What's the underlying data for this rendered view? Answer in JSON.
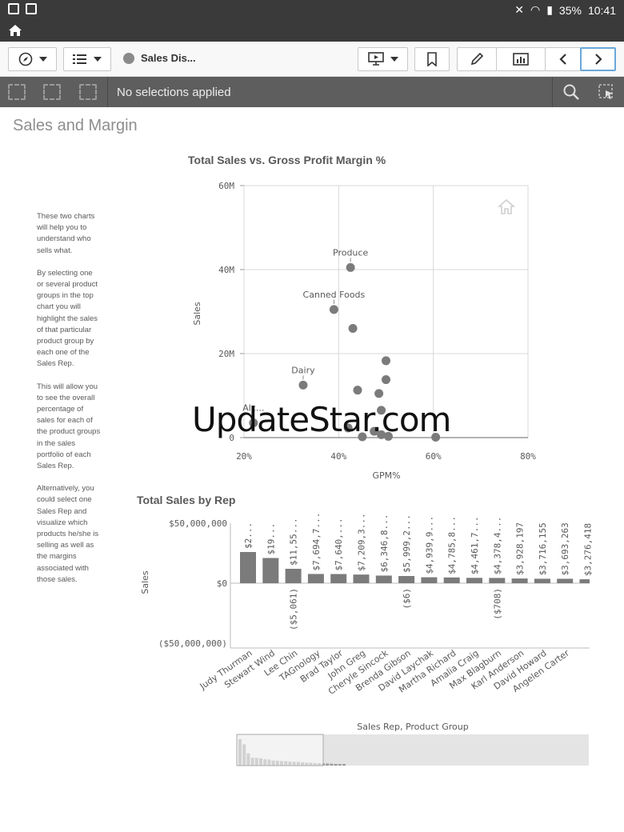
{
  "status": {
    "battery": "35%",
    "time": "10:41"
  },
  "toolbar": {
    "sheet_title": "Sales Dis..."
  },
  "selections": {
    "text": "No selections applied"
  },
  "page": {
    "title": "Sales and Margin"
  },
  "description": [
    "These two charts will help you to understand who sells what.",
    "By selecting one or several product groups in the top chart you will highlight the sales of that particular product group by each one of the Sales Rep.",
    "This will allow you to see the overall percentage of sales for each of the product groups in the sales portfolio of each Sales Rep.",
    "Alternatively, you could select one Sales Rep and visualize which products he/she is selling as well as the margins associated with those sales."
  ],
  "watermark": "UpdateStar.com",
  "colors": {
    "mark": "#7b7b7b",
    "grid": "#d8d8d8",
    "selbar": "#5e5e5e",
    "statusbar": "#3a3a3a"
  },
  "chart_data": [
    {
      "type": "scatter",
      "title": "Total Sales vs. Gross Profit Margin %",
      "xlabel": "GPM%",
      "ylabel": "Sales",
      "xlim": [
        0.2,
        0.8
      ],
      "ylim": [
        0,
        60000000
      ],
      "xticks": [
        "20%",
        "40%",
        "60%",
        "80%"
      ],
      "yticks": [
        "0",
        "20M",
        "40M",
        "60M"
      ],
      "grid": true,
      "points": [
        {
          "x": 0.425,
          "y": 40500000,
          "label": "Produce"
        },
        {
          "x": 0.39,
          "y": 30500000,
          "label": "Canned Foods"
        },
        {
          "x": 0.43,
          "y": 26000000,
          "label": ""
        },
        {
          "x": 0.5,
          "y": 18300000,
          "label": ""
        },
        {
          "x": 0.325,
          "y": 12500000,
          "label": "Dairy"
        },
        {
          "x": 0.5,
          "y": 13800000,
          "label": ""
        },
        {
          "x": 0.44,
          "y": 11300000,
          "label": ""
        },
        {
          "x": 0.485,
          "y": 10500000,
          "label": ""
        },
        {
          "x": 0.49,
          "y": 6500000,
          "label": ""
        },
        {
          "x": 0.22,
          "y": 3500000,
          "label": "Alc..."
        },
        {
          "x": 0.42,
          "y": 2300000,
          "label": ""
        },
        {
          "x": 0.475,
          "y": 1500000,
          "label": ""
        },
        {
          "x": 0.49,
          "y": 700000,
          "label": ""
        },
        {
          "x": 0.45,
          "y": 200000,
          "label": ""
        },
        {
          "x": 0.505,
          "y": 300000,
          "label": ""
        },
        {
          "x": 0.605,
          "y": 100000,
          "label": ""
        }
      ]
    },
    {
      "type": "bar",
      "title": "Total Sales by Rep",
      "ylabel": "Sales",
      "ylim": [
        -50000000,
        50000000
      ],
      "yticks": [
        "$50,000,000",
        "$0",
        "($50,000,000)"
      ],
      "scrollbar_label": "Sales Rep, Product Group",
      "categories": [
        "Judy Thurman",
        "Stewart Wind",
        "Lee Chin",
        "TAGnology",
        "Brad Taylor",
        "John Greg",
        "Cheryle Sincock",
        "Brenda Gibson",
        "David Laychak",
        "Martha Richard",
        "Amalia Craig",
        "Max Blagburn",
        "Karl Anderson",
        "David Howard",
        "Angelen Carter",
        ""
      ],
      "values": [
        26000000,
        21000000,
        12000000,
        7694700,
        7640000,
        7209300,
        6346800,
        5999200,
        4939900,
        4785800,
        4461700,
        4378400,
        3928197,
        3716155,
        3693263,
        3276418
      ],
      "value_labels": [
        "$2...",
        "$19...",
        "$11,55...",
        "$7,694,7...",
        "$7,640,...",
        "$7,209,3...",
        "$6,346,8...",
        "$5,999,2...",
        "$4,939,9...",
        "$4,785,8...",
        "$4,461,7...",
        "$4,378,4...",
        "$3,928,197",
        "$3,716,155",
        "$3,693,263",
        "$3,276,418"
      ],
      "negative_labels": [
        "",
        "",
        "($5,061)",
        "",
        "",
        "",
        "",
        "($6)",
        "",
        "",
        "",
        "($708)",
        "",
        "",
        "",
        ""
      ]
    }
  ]
}
